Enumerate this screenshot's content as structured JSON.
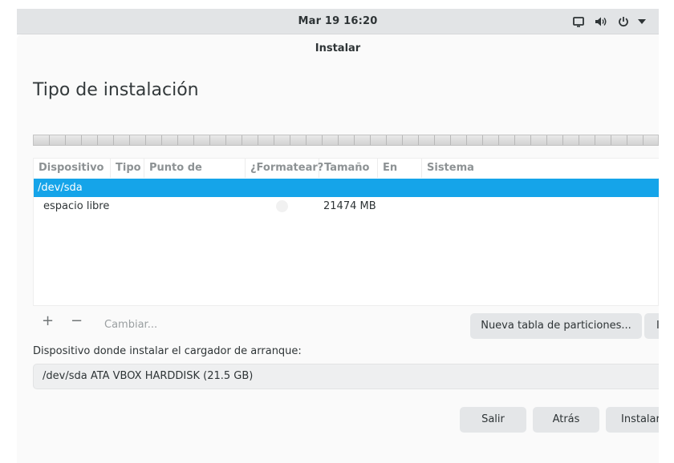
{
  "topbar": {
    "clock": "Mar 19  16:20",
    "icons": [
      "window-icon",
      "volume-icon",
      "power-icon",
      "dropdown-arrow-icon"
    ]
  },
  "window": {
    "title": "Instalar",
    "heading": "Tipo de instalación"
  },
  "partition_table": {
    "columns": [
      "Dispositivo",
      "Tipo",
      "Punto de montaje",
      "¿Formatear?",
      "Tamaño",
      "En uso",
      "Sistema"
    ],
    "device_row": {
      "device": "/dev/sda"
    },
    "rows": [
      {
        "device": "espacio libre",
        "type": "",
        "mount": "",
        "format": false,
        "size": "21474 MB",
        "used": "",
        "system": ""
      }
    ]
  },
  "table_toolbar": {
    "add_label": "+",
    "remove_label": "−",
    "change_label": "Cambiar...",
    "new_table_label": "Nueva tabla de particiones...",
    "revert_label": "I"
  },
  "bootloader": {
    "label": "Dispositivo donde instalar el cargador de arranque:",
    "value": "/dev/sda ATA VBOX HARDDISK (21.5 GB)"
  },
  "actions": {
    "quit_label": "Salir",
    "back_label": "Atrás",
    "install_label": "Instalar"
  },
  "colors": {
    "selection": "#15a4e9",
    "topbar": "#e2e4e6",
    "button": "#e4e6e8"
  }
}
